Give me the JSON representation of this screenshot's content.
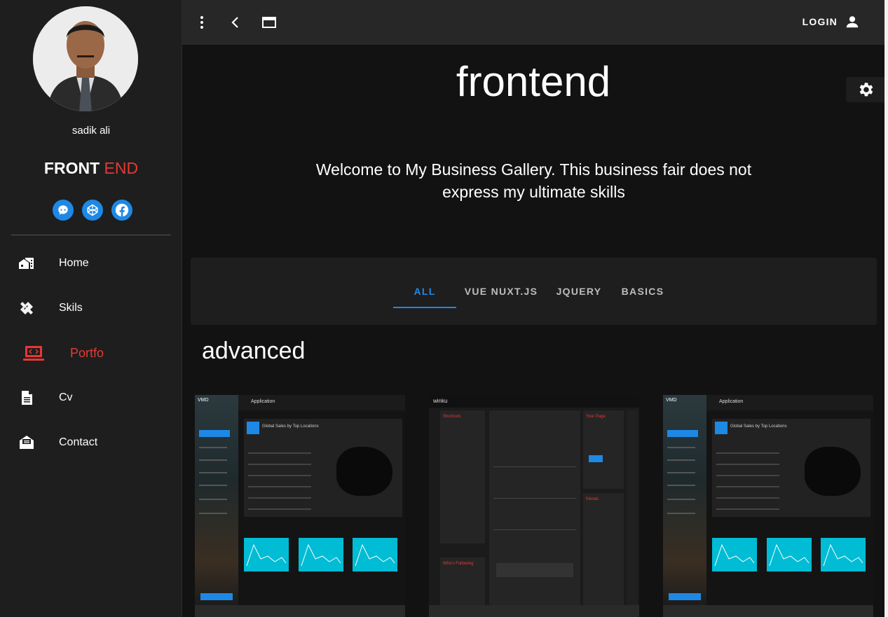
{
  "profile": {
    "name": "sadik ali",
    "brand_part1": "FRONT",
    "brand_part2": " END",
    "socials": [
      "github-icon",
      "codepen-icon",
      "facebook-icon"
    ]
  },
  "nav": [
    {
      "label": "Home",
      "icon": "home-icon"
    },
    {
      "label": "Skils",
      "icon": "tools-icon"
    },
    {
      "label": "Portfo",
      "icon": "laptop-code-icon",
      "active": true
    },
    {
      "label": "Cv",
      "icon": "document-icon"
    },
    {
      "label": "Contact",
      "icon": "mail-icon"
    }
  ],
  "topbar": {
    "login_label": "LOGIN"
  },
  "hero": {
    "title": "frontend",
    "subtitle": "Welcome to My Business Gallery. This business fair does not express my ultimate skills"
  },
  "tabs": [
    {
      "label": "ALL",
      "active": true
    },
    {
      "label": "VUE NUXT.JS"
    },
    {
      "label": "JQUERY"
    },
    {
      "label": "BASICS"
    }
  ],
  "section": {
    "title": "advanced"
  },
  "thumbnails": {
    "admin_brand": "VMD",
    "admin_title": "Application",
    "admin_panel_title": "Global Sales by Top Locations",
    "social_brand": "winku",
    "social_shortcuts": "Shortcuts",
    "social_your_page": "Your Page",
    "social_following": "Who's Following",
    "social_friends": "friends"
  },
  "colors": {
    "accent": "#e53935",
    "primary": "#1e88e5",
    "background": "#121212",
    "sidebar": "#1e1e1e",
    "topbar": "#272727"
  }
}
